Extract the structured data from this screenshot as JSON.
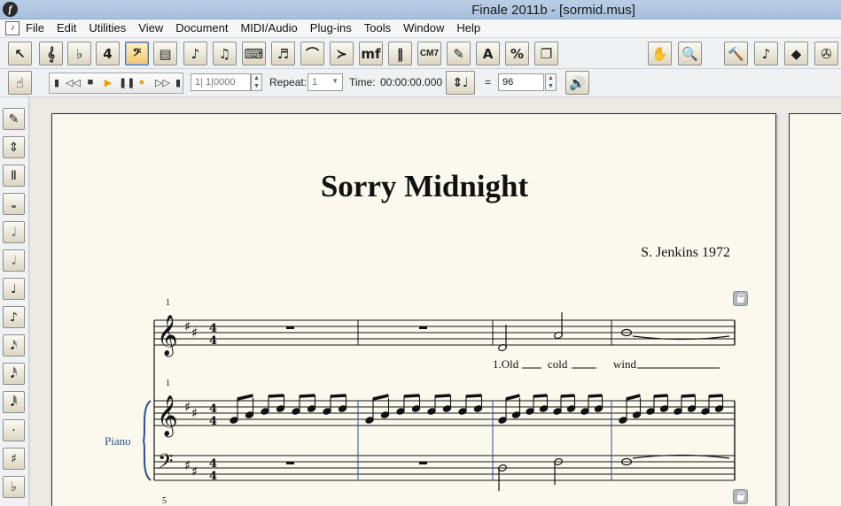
{
  "window": {
    "title": "Finale 2011b - [sormid.mus]",
    "logo": "f"
  },
  "menu": [
    "File",
    "Edit",
    "Utilities",
    "View",
    "Document",
    "MIDI/Audio",
    "Plug-ins",
    "Tools",
    "Window",
    "Help"
  ],
  "toolbar": {
    "tools": [
      {
        "name": "selection-tool",
        "glyph": "↖"
      },
      {
        "name": "staff-tool",
        "glyph": "𝄞"
      },
      {
        "name": "key-signature-tool",
        "glyph": "♭"
      },
      {
        "name": "time-signature-tool",
        "glyph": "4"
      },
      {
        "name": "clef-tool",
        "glyph": "𝄢"
      },
      {
        "name": "measure-tool",
        "glyph": "▤"
      },
      {
        "name": "simple-entry-tool",
        "glyph": "♪"
      },
      {
        "name": "speedy-entry-tool",
        "glyph": "♫"
      },
      {
        "name": "hyperscribe-tool",
        "glyph": "⌨"
      },
      {
        "name": "tuplet-tool",
        "glyph": "♬"
      },
      {
        "name": "smart-shape-tool",
        "glyph": "⌒"
      },
      {
        "name": "articulation-tool",
        "glyph": "≻"
      },
      {
        "name": "expression-tool",
        "glyph": "mf"
      },
      {
        "name": "repeat-tool",
        "glyph": "‖"
      },
      {
        "name": "chord-tool",
        "glyph": "CM7"
      },
      {
        "name": "lyrics-tool",
        "glyph": "✎"
      },
      {
        "name": "text-tool",
        "glyph": "A"
      },
      {
        "name": "resize-tool",
        "glyph": "%"
      },
      {
        "name": "page-layout-tool",
        "glyph": "❐"
      }
    ],
    "right_tools": [
      {
        "name": "hand-grabber-tool",
        "glyph": "✋"
      },
      {
        "name": "zoom-tool",
        "glyph": "🔍"
      },
      {
        "name": "special-tools-tool",
        "glyph": "🔨"
      },
      {
        "name": "mirror-tool",
        "glyph": "♪"
      },
      {
        "name": "graphics-tool",
        "glyph": "◆"
      },
      {
        "name": "midi-tool",
        "glyph": "✇"
      }
    ]
  },
  "playback": {
    "measure_counter": "1| 1|0000",
    "repeat_label": "Repeat:",
    "repeat_value": "1",
    "time_label": "Time:",
    "time_value": "00:00:00.000",
    "equals": "=",
    "tempo": "96"
  },
  "palette": [
    "✎",
    "⇕",
    "Ⅱ",
    "𝅝",
    "𝅗𝅥",
    "𝅗𝅥",
    "♩",
    "♪",
    "𝅘𝅥𝅯",
    "𝅘𝅥𝅰",
    "𝅘𝅥𝅱",
    "·",
    "♯",
    "♭"
  ],
  "score": {
    "title": "Sorry Midnight",
    "composer": "S. Jenkins 1972",
    "instrument": "Piano",
    "measure_numbers": [
      "1",
      "1",
      "5"
    ],
    "lyrics": [
      "1.Old",
      "cold",
      "wind"
    ]
  }
}
